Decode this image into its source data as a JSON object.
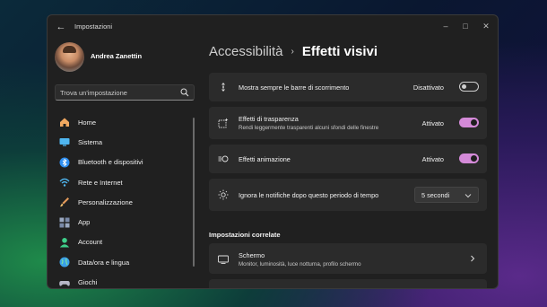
{
  "window": {
    "app_title": "Impostazioni",
    "controls": [
      "minimize",
      "maximize",
      "close"
    ]
  },
  "user": {
    "name": "Andrea Zanettin"
  },
  "search": {
    "placeholder": "Trova un'impostazione"
  },
  "sidebar": {
    "items": [
      {
        "label": "Home",
        "icon": "home-icon",
        "color": "#f0a860"
      },
      {
        "label": "Sistema",
        "icon": "system-icon",
        "color": "#4fb6f0"
      },
      {
        "label": "Bluetooth e dispositivi",
        "icon": "bluetooth-icon",
        "color": "#2f8ff0"
      },
      {
        "label": "Rete e Internet",
        "icon": "wifi-icon",
        "color": "#4fb6f0"
      },
      {
        "label": "Personalizzazione",
        "icon": "brush-icon",
        "color": "#e49a5a"
      },
      {
        "label": "App",
        "icon": "apps-icon",
        "color": "#9aa8c0"
      },
      {
        "label": "Account",
        "icon": "account-icon",
        "color": "#3ecf8a"
      },
      {
        "label": "Data/ora e lingua",
        "icon": "globe-icon",
        "color": "#3aa0e8"
      },
      {
        "label": "Giochi",
        "icon": "gamepad-icon",
        "color": "#b8b8c8"
      }
    ]
  },
  "breadcrumb": {
    "parent": "Accessibilità",
    "separator": "›",
    "current": "Effetti visivi"
  },
  "settings": [
    {
      "title": "Mostra sempre le barre di scorrimento",
      "subtitle": "",
      "state": "Disattivato",
      "on": false,
      "icon": "scrollbar-icon"
    },
    {
      "title": "Effetti di trasparenza",
      "subtitle": "Rendi leggermente trasparenti alcuni sfondi delle finestre",
      "state": "Attivato",
      "on": true,
      "icon": "transparency-icon"
    },
    {
      "title": "Effetti animazione",
      "subtitle": "",
      "state": "Attivato",
      "on": true,
      "icon": "animation-icon"
    },
    {
      "title": "Ignora le notifiche dopo questo periodo di tempo",
      "subtitle": "",
      "dropdown_value": "5 secondi",
      "icon": "brightness-icon"
    }
  ],
  "related": {
    "heading": "Impostazioni correlate",
    "items": [
      {
        "title": "Schermo",
        "subtitle": "Monitor, luminosità, luce notturna, profilo schermo",
        "icon": "monitor-icon"
      }
    ]
  },
  "colors": {
    "accent": "#d48ad8",
    "window_bg": "#202020",
    "card_bg": "#2b2b2b"
  }
}
